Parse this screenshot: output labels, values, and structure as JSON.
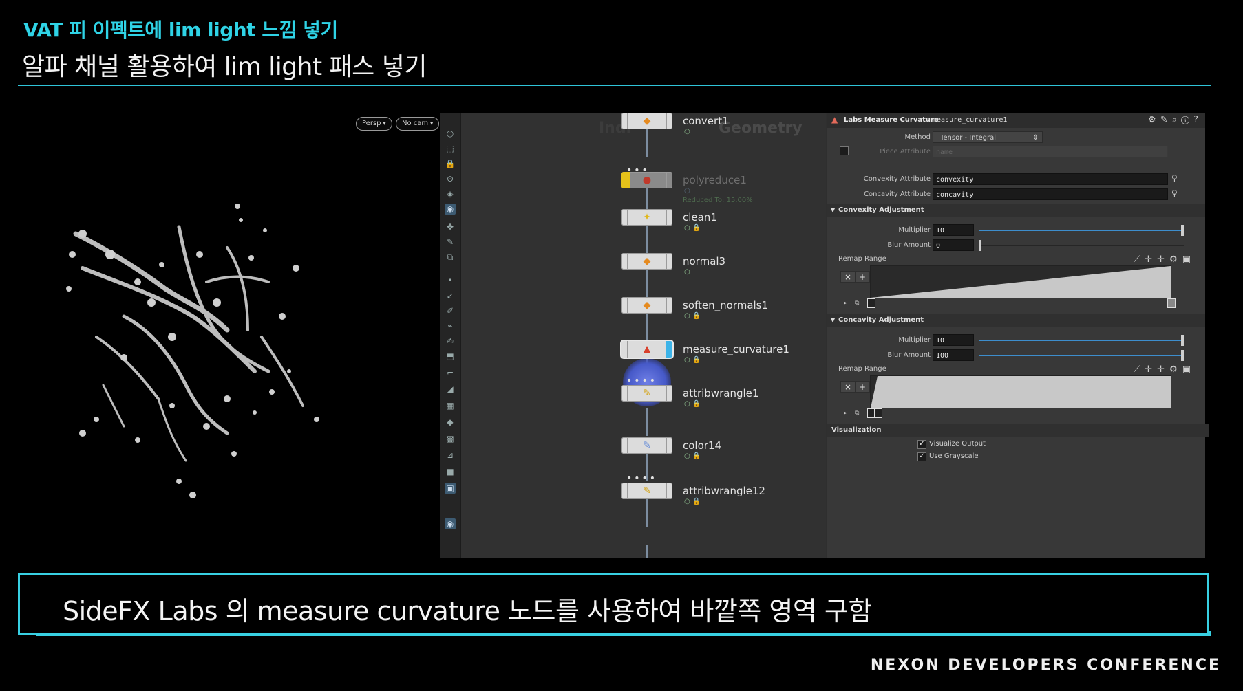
{
  "slide": {
    "kicker": "VAT 피 이펙트에 lim light 느낌 넣기",
    "headline": "알파 채널 활용하여 lim light 패스 넣기",
    "caption": "SideFX Labs 의 measure curvature 노드를 사용하여 바깥쪽 영역 구함",
    "footer": "NEXON DEVELOPERS CONFERENCE",
    "accent_color": "#2fd3e6"
  },
  "viewport": {
    "camera_menu": "Persp",
    "cam_menu": "No cam"
  },
  "network": {
    "bg_left": "Indi",
    "bg_right": "Geometry",
    "nodes": [
      {
        "name": "convert1",
        "icon": "convert-icon"
      },
      {
        "name": "polyreduce1",
        "icon": "polyreduce-icon",
        "sub": "Reduced To: 15.00%",
        "bypassed": true
      },
      {
        "name": "clean1",
        "icon": "clean-icon"
      },
      {
        "name": "normal3",
        "icon": "normal-icon"
      },
      {
        "name": "soften_normals1",
        "icon": "soften-icon"
      },
      {
        "name": "measure_curvature1",
        "icon": "curvature-icon",
        "selected": true
      },
      {
        "name": "attribwrangle1",
        "icon": "wrangle-icon"
      },
      {
        "name": "color14",
        "icon": "color-icon"
      },
      {
        "name": "attribwrangle12",
        "icon": "wrangle-icon"
      }
    ]
  },
  "params": {
    "node_type": "Labs Measure Curvature",
    "node_name": "measure_curvature1",
    "method_label": "Method",
    "method_value": "Tensor - Integral",
    "piece_attr_label": "Piece Attribute",
    "piece_attr_placeholder": "name",
    "convexity_attr_label": "Convexity Attribute",
    "convexity_attr_value": "convexity",
    "concavity_attr_label": "Concavity Attribute",
    "concavity_attr_value": "concavity",
    "convexity_section": "Convexity Adjustment",
    "concavity_section": "Concavity Adjustment",
    "visualization_section": "Visualization",
    "multiplier_label": "Multiplier",
    "blur_label": "Blur Amount",
    "remap_label": "Remap Range",
    "convexity_multiplier": "10",
    "convexity_blur": "0",
    "concavity_multiplier": "10",
    "concavity_blur": "100",
    "convexity_multiplier_level": 1.0,
    "convexity_blur_level": 0.0,
    "concavity_multiplier_level": 1.0,
    "concavity_blur_level": 1.0,
    "visualize_output": "Visualize Output",
    "use_grayscale": "Use Grayscale"
  }
}
